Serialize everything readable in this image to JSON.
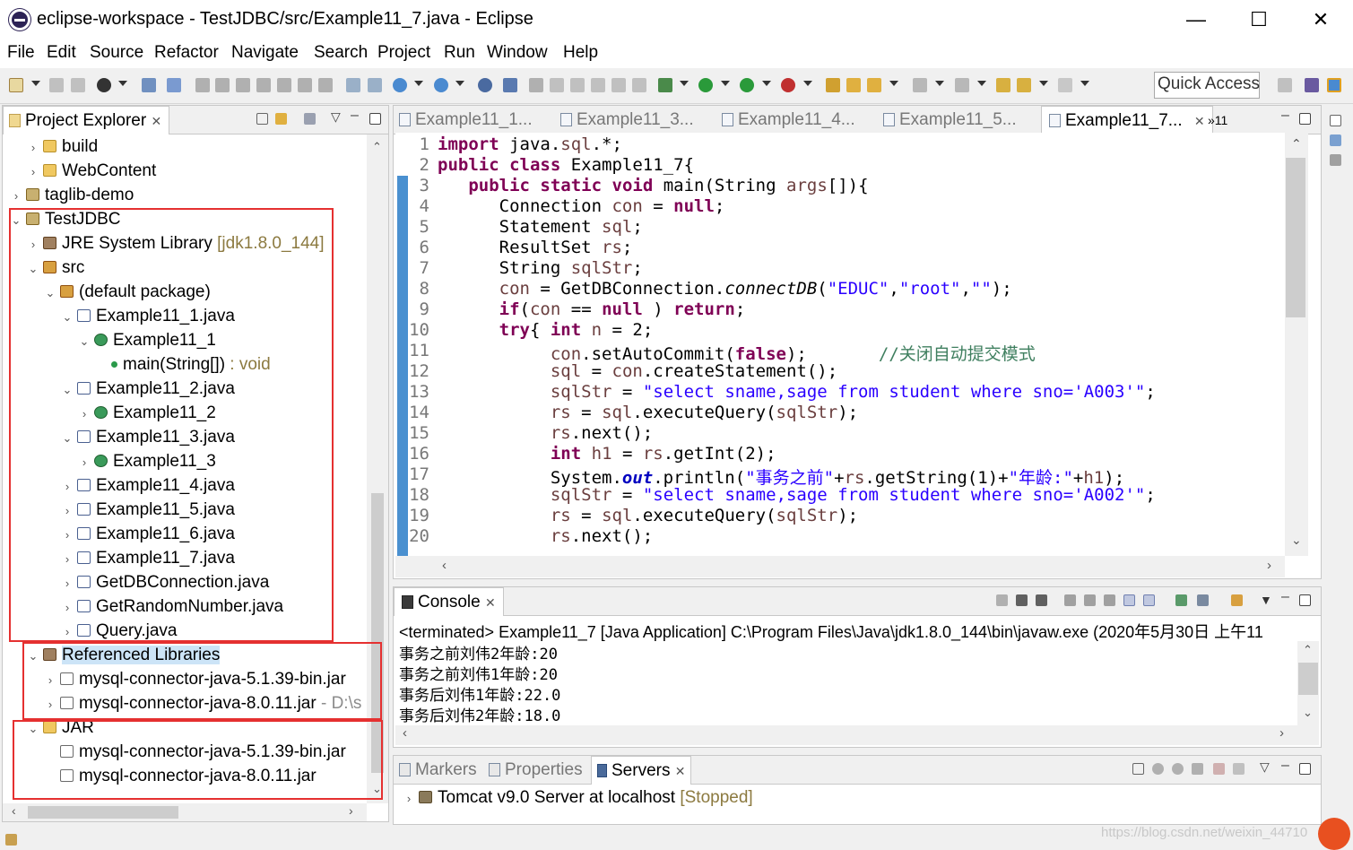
{
  "window": {
    "title": "eclipse-workspace - TestJDBC/src/Example11_7.java - Eclipse"
  },
  "menu": [
    "File",
    "Edit",
    "Source",
    "Refactor",
    "Navigate",
    "Search",
    "Project",
    "Run",
    "Window",
    "Help"
  ],
  "quick_access": "Quick Access",
  "project_explorer": {
    "tab": "Project Explorer",
    "rows": [
      {
        "label": "build",
        "indent": 1,
        "icon": "folder-icon",
        "chev": "›"
      },
      {
        "label": "WebContent",
        "indent": 1,
        "icon": "folder-icon",
        "chev": "›"
      },
      {
        "label": "taglib-demo",
        "indent": 0,
        "icon": "project-icon",
        "chev": "›"
      },
      {
        "label": "TestJDBC",
        "indent": 0,
        "icon": "project-icon",
        "chev": "⌄"
      },
      {
        "label": "JRE System Library",
        "suffix": " [jdk1.8.0_144]",
        "indent": 1,
        "icon": "library-icon",
        "chev": "›"
      },
      {
        "label": "src",
        "indent": 1,
        "icon": "source-folder-icon",
        "chev": "⌄"
      },
      {
        "label": "(default package)",
        "indent": 2,
        "icon": "package-icon",
        "chev": "⌄"
      },
      {
        "label": "Example11_1.java",
        "indent": 3,
        "icon": "java-file-icon",
        "chev": "⌄"
      },
      {
        "label": "Example11_1",
        "indent": 4,
        "icon": "class-icon",
        "chev": "⌄"
      },
      {
        "label": "main(String[])",
        "suffix": " : void",
        "indent": 5,
        "icon": "method-icon",
        "chev": ""
      },
      {
        "label": "Example11_2.java",
        "indent": 3,
        "icon": "java-file-icon",
        "chev": "⌄"
      },
      {
        "label": "Example11_2",
        "indent": 4,
        "icon": "class-icon",
        "chev": "›"
      },
      {
        "label": "Example11_3.java",
        "indent": 3,
        "icon": "java-file-icon",
        "chev": "⌄"
      },
      {
        "label": "Example11_3",
        "indent": 4,
        "icon": "class-icon",
        "chev": "›"
      },
      {
        "label": "Example11_4.java",
        "indent": 3,
        "icon": "java-file-icon",
        "chev": "›"
      },
      {
        "label": "Example11_5.java",
        "indent": 3,
        "icon": "java-file-icon",
        "chev": "›"
      },
      {
        "label": "Example11_6.java",
        "indent": 3,
        "icon": "java-file-icon",
        "chev": "›"
      },
      {
        "label": "Example11_7.java",
        "indent": 3,
        "icon": "java-file-icon",
        "chev": "›"
      },
      {
        "label": "GetDBConnection.java",
        "indent": 3,
        "icon": "java-file-icon",
        "chev": "›"
      },
      {
        "label": "GetRandomNumber.java",
        "indent": 3,
        "icon": "java-file-icon",
        "chev": "›"
      },
      {
        "label": "Query.java",
        "indent": 3,
        "icon": "java-file-icon",
        "chev": "›"
      },
      {
        "label": "Referenced Libraries",
        "indent": 1,
        "icon": "library-icon",
        "chev": "⌄",
        "selected": true
      },
      {
        "label": "mysql-connector-java-5.1.39-bin.jar",
        "indent": 2,
        "icon": "jar-icon",
        "chev": "›"
      },
      {
        "label": "mysql-connector-java-8.0.11.jar",
        "suffix": " - D:\\s",
        "indent": 2,
        "icon": "jar-icon",
        "chev": "›"
      },
      {
        "label": "JAR",
        "indent": 1,
        "icon": "folder-icon",
        "chev": "⌄"
      },
      {
        "label": "mysql-connector-java-5.1.39-bin.jar",
        "indent": 2,
        "icon": "file-icon",
        "chev": ""
      },
      {
        "label": "mysql-connector-java-8.0.11.jar",
        "indent": 2,
        "icon": "file-icon",
        "chev": ""
      }
    ]
  },
  "editor": {
    "tabs": [
      "Example11_1...",
      "Example11_3...",
      "Example11_4...",
      "Example11_5...",
      "Example11_7..."
    ],
    "overflow": "»11",
    "lines": [
      {
        "n": "1",
        "t": "import java.sql.*;"
      },
      {
        "n": "2",
        "t": "public class Example11_7{"
      },
      {
        "n": "3",
        "t": "   public static void main(String args[]){"
      },
      {
        "n": "4",
        "t": "      Connection con = null;"
      },
      {
        "n": "5",
        "t": "      Statement sql;"
      },
      {
        "n": "6",
        "t": "      ResultSet rs;"
      },
      {
        "n": "7",
        "t": "      String sqlStr;"
      },
      {
        "n": "8",
        "t": "      con = GetDBConnection.connectDB(\"EDUC\",\"root\",\"\");"
      },
      {
        "n": "9",
        "t": "      if(con == null ) return;"
      },
      {
        "n": "10",
        "t": "      try{ int n = 2;"
      },
      {
        "n": "11",
        "t": "           con.setAutoCommit(false);       //关闭自动提交模式"
      },
      {
        "n": "12",
        "t": "           sql = con.createStatement();"
      },
      {
        "n": "13",
        "t": "           sqlStr = \"select sname,sage from student where sno='A003'\";"
      },
      {
        "n": "14",
        "t": "           rs = sql.executeQuery(sqlStr);"
      },
      {
        "n": "15",
        "t": "           rs.next();"
      },
      {
        "n": "16",
        "t": "           int h1 = rs.getInt(2);"
      },
      {
        "n": "17",
        "t": "           System.out.println(\"事务之前\"+rs.getString(1)+\"年龄:\"+h1);"
      },
      {
        "n": "18",
        "t": "           sqlStr = \"select sname,sage from student where sno='A002'\";"
      },
      {
        "n": "19",
        "t": "           rs = sql.executeQuery(sqlStr);"
      },
      {
        "n": "20",
        "t": "           rs.next();"
      }
    ]
  },
  "console": {
    "tab": "Console",
    "header": "<terminated> Example11_7 [Java Application] C:\\Program Files\\Java\\jdk1.8.0_144\\bin\\javaw.exe (2020年5月30日 上午11",
    "lines": [
      "事务之前刘伟2年龄:20",
      "事务之前刘伟1年龄:20",
      "事务后刘伟1年龄:22.0",
      "事务后刘伟2年龄:18.0"
    ]
  },
  "servers": {
    "tabs": [
      "Markers",
      "Properties",
      "Servers"
    ],
    "row_label": "Tomcat v9.0 Server at localhost",
    "row_status": "[Stopped]"
  },
  "watermark": "https://blog.csdn.net/weixin_44710"
}
